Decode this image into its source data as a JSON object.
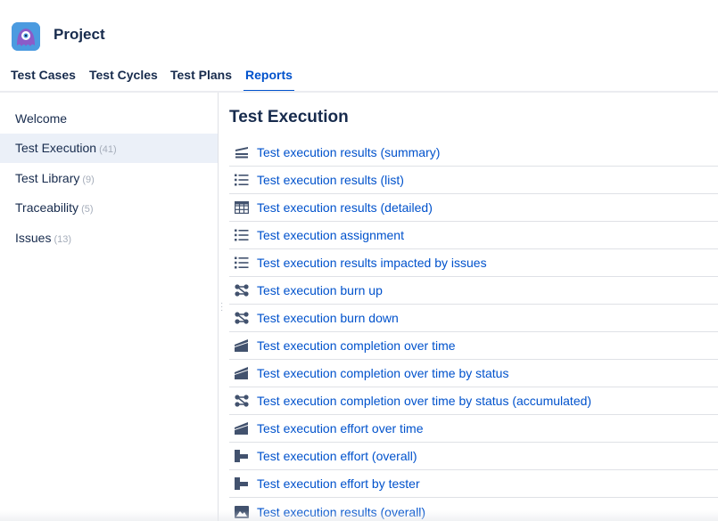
{
  "header": {
    "logo_icon": "octopus-avatar-icon",
    "title": "Project"
  },
  "tabs": [
    {
      "label": "Test Cases",
      "active": false
    },
    {
      "label": "Test Cycles",
      "active": false
    },
    {
      "label": "Test Plans",
      "active": false
    },
    {
      "label": "Reports",
      "active": true
    }
  ],
  "sidebar": {
    "items": [
      {
        "label": "Welcome",
        "count": ""
      },
      {
        "label": "Test Execution",
        "count": "(41)",
        "active": true
      },
      {
        "label": "Test Library",
        "count": "(9)"
      },
      {
        "label": "Traceability",
        "count": "(5)"
      },
      {
        "label": "Issues",
        "count": "(13)"
      }
    ]
  },
  "main": {
    "section_title": "Test Execution",
    "reports": [
      {
        "label": "Test execution results (summary)",
        "icon": "summary-chart-icon"
      },
      {
        "label": "Test execution results (list)",
        "icon": "list-icon"
      },
      {
        "label": "Test execution results (detailed)",
        "icon": "grid-table-icon"
      },
      {
        "label": "Test execution assignment",
        "icon": "list-icon"
      },
      {
        "label": "Test execution results impacted by issues",
        "icon": "list-icon"
      },
      {
        "label": "Test execution burn up",
        "icon": "burn-chart-icon"
      },
      {
        "label": "Test execution burn down",
        "icon": "burn-chart-icon"
      },
      {
        "label": "Test execution completion over time",
        "icon": "area-chart-icon"
      },
      {
        "label": "Test execution completion over time by status",
        "icon": "area-chart-icon"
      },
      {
        "label": "Test execution completion over time by status (accumulated)",
        "icon": "burn-chart-icon"
      },
      {
        "label": "Test execution effort over time",
        "icon": "area-chart-icon"
      },
      {
        "label": "Test execution effort (overall)",
        "icon": "bar-chart-icon"
      },
      {
        "label": "Test execution effort by tester",
        "icon": "bar-chart-icon"
      },
      {
        "label": "Test execution results (overall)",
        "icon": "image-chart-icon"
      }
    ]
  },
  "colors": {
    "link": "#0052cc",
    "active_bg": "#ebf0f8",
    "icon": "#42526e",
    "count": "#a5adba"
  }
}
